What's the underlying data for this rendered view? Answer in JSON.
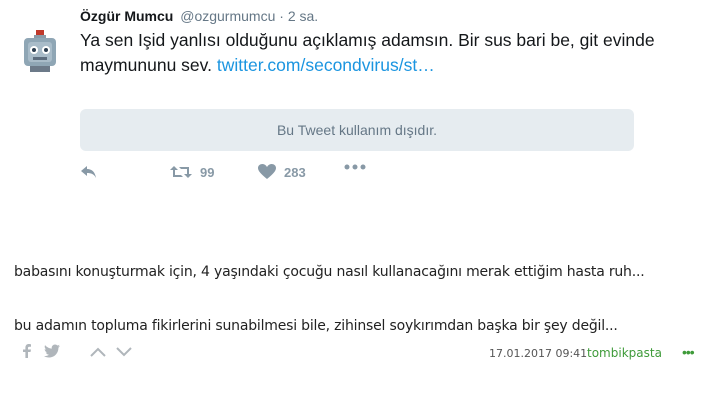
{
  "tweet": {
    "author_name": "Özgür Mumcu",
    "handle": "@ozgurmumcu",
    "separator": "·",
    "time": "2 sa.",
    "text_main": "Ya sen Işid yanlısı olduğunu açıklamış adamsın. Bir sus bari be, git evinde maymununu sev.",
    "text_link": "twitter.com/secondvirus/st…",
    "withheld_notice": "Bu Tweet kullanım dışıdır.",
    "retweet_count": "99",
    "like_count": "283",
    "icons": [
      "reply-icon",
      "retweet-icon",
      "heart-icon",
      "more-icon"
    ]
  },
  "comments": [
    {
      "text": "babasını konuşturmak için, 4 yaşındaki çocuğu nasıl kullanacağını merak ettiğim hasta ruh..."
    },
    {
      "text": "bu adamın topluma fikirlerini sunabilmesi bile, zihinsel soykırımdan başka bir şey değil..."
    }
  ],
  "entry_footer": {
    "date": "17.01.2017 09:41",
    "author": "tombikpasta",
    "more_label": "•••",
    "icons": [
      "facebook-icon",
      "twitter-icon",
      "upvote-icon",
      "downvote-icon"
    ]
  },
  "colors": {
    "link": "#1b95e0",
    "muted": "#657786",
    "author_green": "#3f9b3a",
    "withheld_bg": "#e6ecf0"
  }
}
